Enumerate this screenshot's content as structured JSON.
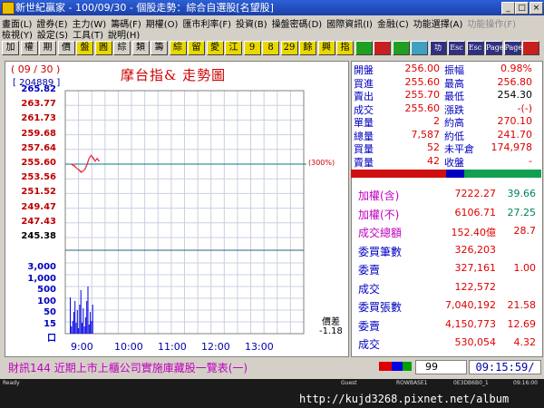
{
  "window": {
    "title": "新世紀贏家 - 100/09/30 - 個股走勢：綜合自選股[名望股]"
  },
  "menu": {
    "row1": [
      "畫面(L)",
      "證券(E)",
      "主力(W)",
      "籌碼(F)",
      "期權(O)",
      "匯市利率(F)",
      "投資(B)",
      "操盤密碼(D)",
      "國際資訊(I)",
      "金融(C)",
      "功能選擇(A)",
      "功能操作(F)"
    ],
    "row2": [
      "檢視(Y)",
      "設定(S)",
      "工具(T)",
      "說明(H)"
    ]
  },
  "toolbar": {
    "buttons": [
      "加",
      "權",
      "期",
      "價",
      "盤",
      "圓",
      "綜",
      "類",
      "籌",
      "綜",
      "留",
      "愛",
      "江",
      "9",
      "8",
      "29",
      "餘",
      "興",
      "指",
      "",
      "",
      "",
      "",
      "功",
      "Esc",
      "Esc",
      "Page Up",
      "Page Down",
      ""
    ]
  },
  "chart": {
    "date": "( 09 / 30 )",
    "code": "[ 204889 ]",
    "title": "摩台指& 走勢圖",
    "ref_tag": "(300%)",
    "diff_label": "價差",
    "diff_value": "-1.18",
    "price_ticks": [
      "265.82",
      "263.77",
      "261.73",
      "259.68",
      "257.64",
      "255.60",
      "253.56",
      "251.52",
      "249.47",
      "247.43",
      "245.38"
    ],
    "volume_ticks": [
      "3,000",
      "1,000",
      "500",
      "100",
      "50",
      "15",
      "口"
    ],
    "time_ticks": [
      "9:00",
      "10:00",
      "11:00",
      "12:00",
      "13:00"
    ]
  },
  "chart_data": {
    "type": "line",
    "title": "摩台指& 走勢圖",
    "xlabel": "",
    "ylabel": "",
    "x": [
      "9:00",
      "9:02",
      "9:04",
      "9:06",
      "9:08",
      "9:10",
      "9:12",
      "9:14",
      "9:16",
      "9:18",
      "9:20",
      "9:22",
      "9:24",
      "9:26",
      "9:28"
    ],
    "series": [
      {
        "values": [
          255.6,
          255.5,
          255.3,
          255.0,
          254.8,
          254.5,
          254.6,
          254.9,
          255.5,
          256.4,
          256.8,
          256.5,
          256.0,
          256.4,
          256.0
        ]
      }
    ],
    "reference_price": 255.6,
    "ylim": [
      245.38,
      265.82
    ],
    "volume_values": [
      1000,
      200,
      350,
      600,
      900,
      300,
      650,
      150,
      800,
      1200,
      300,
      700,
      200,
      450,
      900,
      1300,
      250,
      600,
      350,
      800
    ],
    "grid": true
  },
  "quotes": [
    {
      "l1": "開盤",
      "v1": "256.00",
      "l2": "振幅",
      "v2": "0.98%",
      "c1": "red",
      "c2": "red"
    },
    {
      "l1": "買進",
      "v1": "255.60",
      "l2": "最高",
      "v2": "256.80",
      "c1": "red",
      "c2": "red"
    },
    {
      "l1": "賣出",
      "v1": "255.70",
      "l2": "最低",
      "v2": "254.30",
      "c1": "red",
      "c2": "blk"
    },
    {
      "l1": "成交",
      "v1": "255.60",
      "l2": "漲跌",
      "v2": "-(-)",
      "c1": "red",
      "c2": "red"
    },
    {
      "l1": "單量",
      "v1": "2",
      "l2": "約高",
      "v2": "270.10",
      "c1": "red",
      "c2": "red"
    },
    {
      "l1": "總量",
      "v1": "7,587",
      "l2": "約低",
      "v2": "241.70",
      "c1": "red",
      "c2": "red"
    },
    {
      "l1": "買量",
      "v1": "52",
      "l2": "未平倉",
      "v2": "174,978",
      "c1": "red",
      "c2": "red"
    },
    {
      "l1": "賣量",
      "v1": "42",
      "l2": "收盤",
      "v2": "-",
      "c1": "red",
      "c2": "red"
    }
  ],
  "market": [
    {
      "label": "加權(含)",
      "v1": "7222.27",
      "v2": "39.66",
      "c2": "grn"
    },
    {
      "label": "加權(不)",
      "v1": "6106.71",
      "v2": "27.25",
      "c2": "grn"
    },
    {
      "label": "成交總額",
      "v1": "152.40億",
      "v2": "28.7",
      "c2": "red"
    },
    {
      "label": "委買筆數",
      "v1": "326,203",
      "v2": "",
      "c2": "red"
    },
    {
      "label": "委賣",
      "v1": "327,161",
      "v2": "1.00",
      "c2": "red"
    },
    {
      "label": "成交",
      "v1": "122,572",
      "v2": "",
      "c2": "red"
    },
    {
      "label": "委買張數",
      "v1": "7,040,192",
      "v2": "21.58",
      "c2": "red"
    },
    {
      "label": "委賣",
      "v1": "4,150,773",
      "v2": "12.69",
      "c2": "red"
    },
    {
      "label": "成交",
      "v1": "530,054",
      "v2": "4.32",
      "c2": "red"
    }
  ],
  "status": {
    "message": "財訊144 近期上市上櫃公司實施庫藏股一覽表(一)",
    "page": "99",
    "clock": "09:15:59/",
    "ready": "Ready",
    "guest": "Guest",
    "server": "ROWBASE1",
    "extra": "0E3DB6B0_1",
    "time": "09:16:00"
  },
  "watermark": "http://kujd3268.pixnet.net/album",
  "colors": {
    "accent": "#2d5fd6",
    "price_line": "#e00000",
    "ref_line": "#008080",
    "volume_bar": "#0000e0",
    "label_blue": "#0000c0",
    "label_purple": "#c000c0"
  }
}
